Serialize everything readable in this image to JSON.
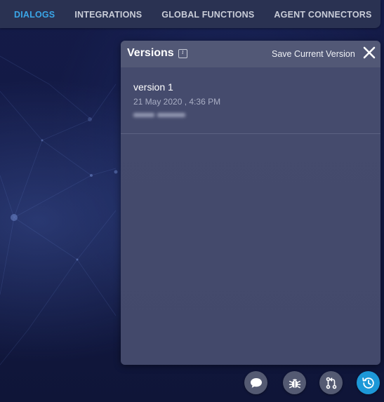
{
  "nav": {
    "tabs": [
      {
        "label": "DIALOGS",
        "active": true
      },
      {
        "label": "INTEGRATIONS",
        "active": false
      },
      {
        "label": "GLOBAL FUNCTIONS",
        "active": false
      },
      {
        "label": "AGENT CONNECTORS",
        "active": false
      }
    ],
    "more_icon": "more-horizontal-icon"
  },
  "versions_panel": {
    "title": "Versions",
    "info_icon": "info-icon",
    "save_label": "Save Current Version",
    "close_icon": "close-icon",
    "items": [
      {
        "name": "version 1",
        "date": "21 May 2020 , 4:36 PM",
        "author": "",
        "author_blurred": true
      }
    ]
  },
  "actions": [
    {
      "icon": "chat-icon"
    },
    {
      "icon": "bug-icon"
    },
    {
      "icon": "git-pull-request-icon"
    },
    {
      "icon": "history-icon",
      "active": true
    }
  ],
  "colors": {
    "background": "#141b48",
    "nav_bar": "#2a3252",
    "active_tab": "#3aa6e8",
    "panel": "#454b6d",
    "panel_header": "#525876",
    "action_button": "#545a72",
    "action_button_active": "#1d98d8"
  }
}
